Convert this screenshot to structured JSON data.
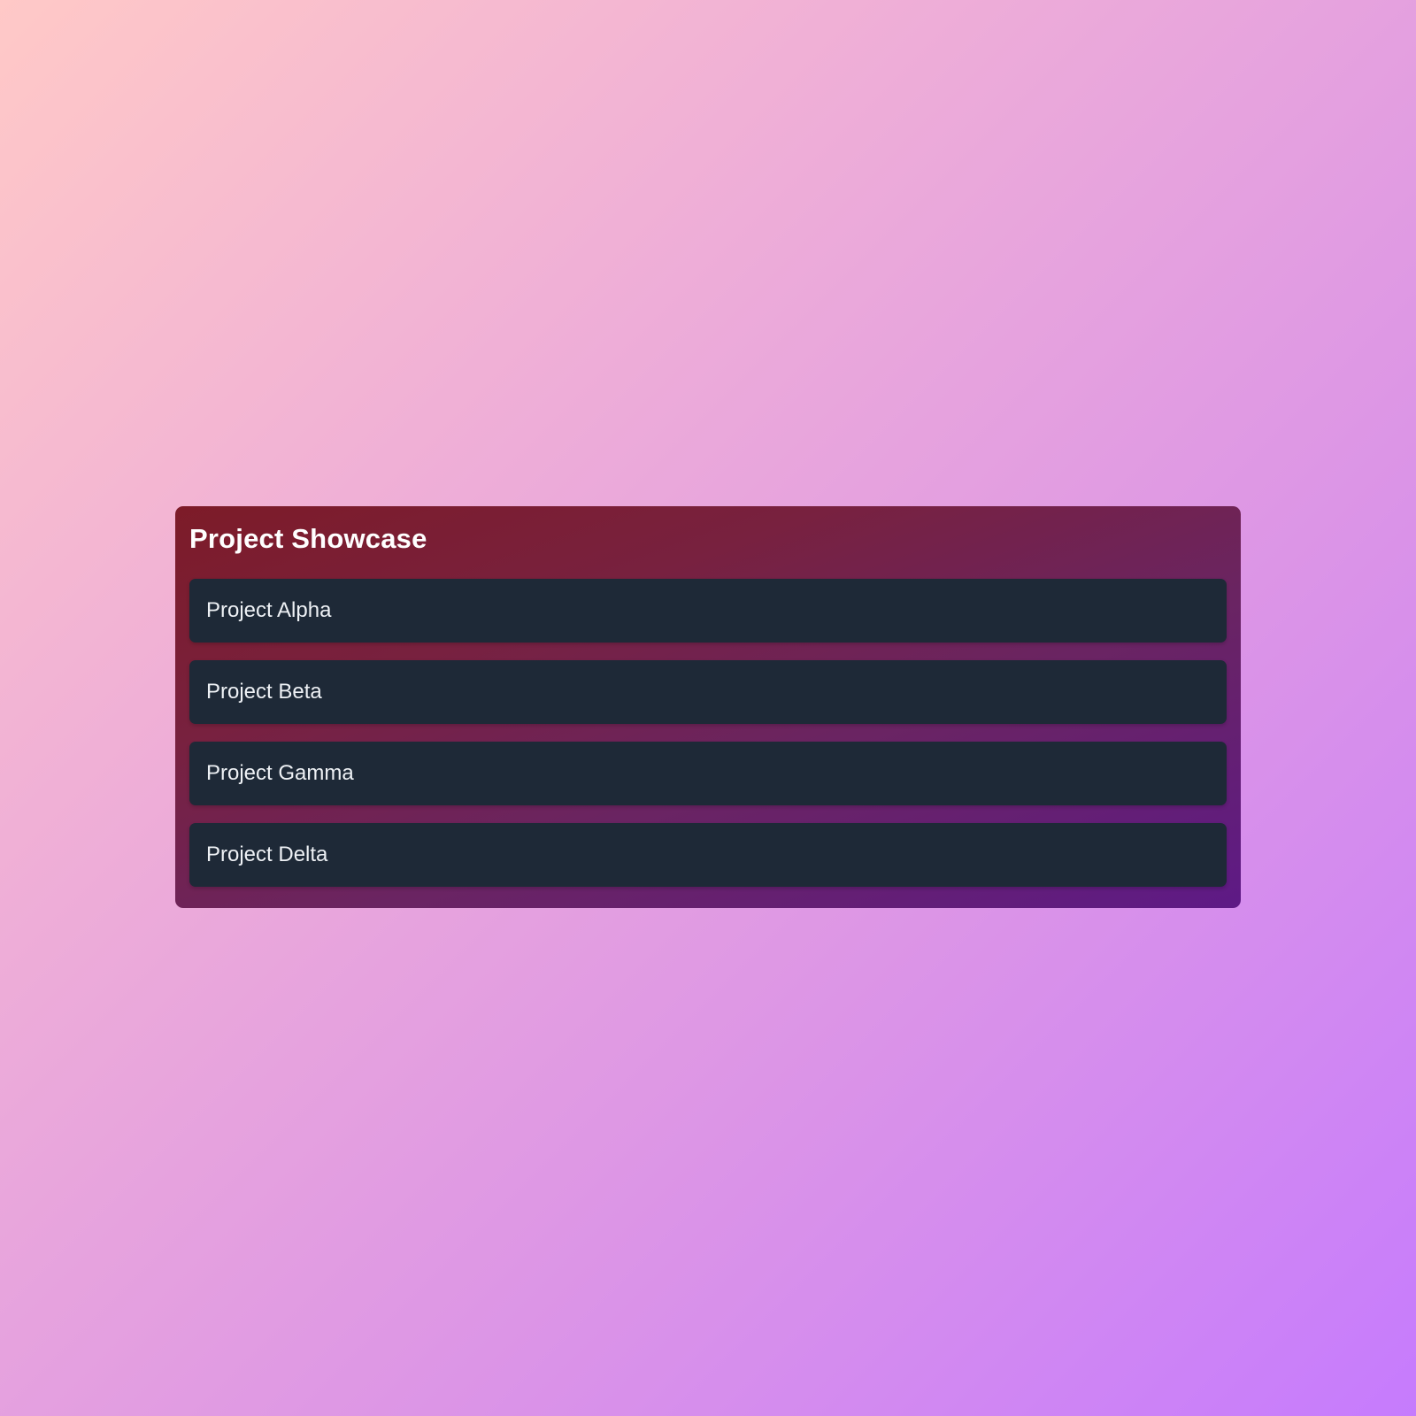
{
  "showcase": {
    "title": "Project Showcase",
    "projects": [
      {
        "label": "Project Alpha"
      },
      {
        "label": "Project Beta"
      },
      {
        "label": "Project Gamma"
      },
      {
        "label": "Project Delta"
      }
    ]
  },
  "colors": {
    "page_gradient_start": "#ffc9c7",
    "page_gradient_end": "#c67bfd",
    "panel_gradient_start": "#7d1b28",
    "panel_gradient_end": "#5e1a86",
    "item_background": "#1e2937",
    "text": "#ffffff"
  }
}
